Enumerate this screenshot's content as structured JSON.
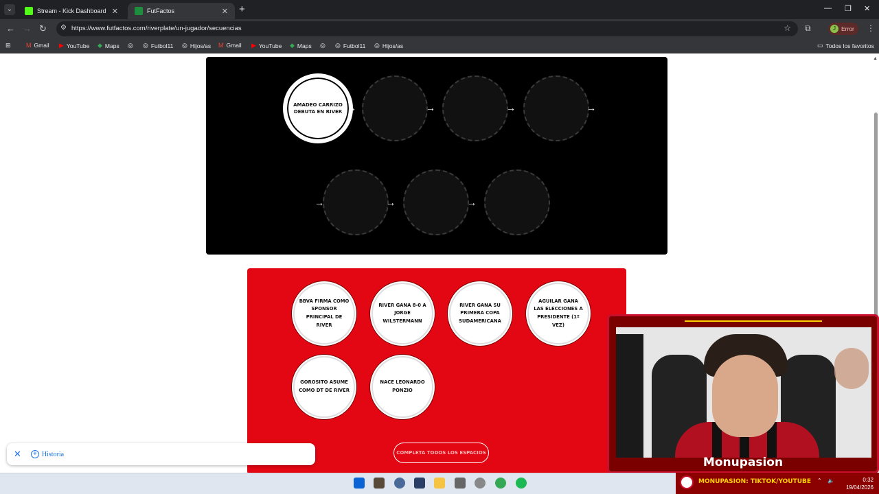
{
  "browser": {
    "tabs": [
      {
        "title": "Stream - Kick Dashboard",
        "favicon_color": "#53fc18"
      },
      {
        "title": "FutFactos",
        "favicon_color": "#1e8e3e"
      }
    ],
    "url": "https://www.futfactos.com/riverplate/un-jugador/secuencias",
    "profile_label": "Error",
    "profile_initial": "J",
    "bookmarks": [
      "Gmail",
      "YouTube",
      "Maps",
      "",
      "Futbol11",
      "Hijos/as",
      "Gmail",
      "YouTube",
      "Maps",
      "",
      "Futbol11",
      "Hijos/as"
    ],
    "all_bookmarks": "Todos los favoritos"
  },
  "sequence": {
    "first_event": "AMADEO CARRIZO DEBUTA EN RIVER",
    "slot_count": 7
  },
  "pool": {
    "cards": [
      "BBVA FIRMA COMO SPONSOR PRINCIPAL DE RIVER",
      "RIVER GANA 8-0 A JORGE WILSTERMANN",
      "RIVER GANA SU PRIMERA COPA SUDAMERICANA",
      "AGUILAR GANA LAS ELECCIONES A PRESIDENTE (1º VEZ)",
      "GOROSITO ASUME COMO DT DE RIVER",
      "NACE LEONARDO PONZIO"
    ],
    "button_label": "COMPLETA TODOS LOS ESPACIOS"
  },
  "history": {
    "label": "Historia"
  },
  "stream": {
    "name": "Monupasion",
    "ticker": "MONUPASION: TIKTOK/YOUTUBE"
  },
  "taskbar": {
    "time": "0:32",
    "date": "19/04/2026"
  },
  "colors": {
    "board": "#000000",
    "pool": "#e30613",
    "accent": "#c8102e"
  }
}
